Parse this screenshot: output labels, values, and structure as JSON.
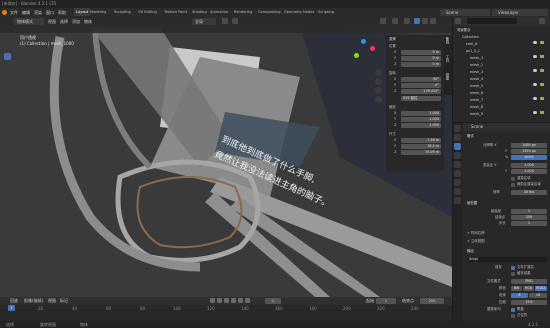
{
  "window_title": "[未保存] - Blender 4.2.1 LTS",
  "menu": [
    "文件",
    "编辑",
    "渲染",
    "窗口",
    "帮助"
  ],
  "workspaces": [
    "Layout",
    "Modeling",
    "Sculpting",
    "UV Editing",
    "Texture Paint",
    "Shading",
    "Animation",
    "Rendering",
    "Compositing",
    "Geometry Nodes",
    "Scripting"
  ],
  "active_workspace": "Layout",
  "header_right": {
    "scene": "Scene",
    "view_layer": "ViewLayer"
  },
  "viewport": {
    "mode": "物体模式",
    "menus": [
      "视图",
      "选择",
      "添加",
      "物体"
    ],
    "orientation": "全局",
    "info_title": "用户透视",
    "info_sub": "(1) Collection | mesh_1000",
    "overlay_text_line1": "到底他到底做了什么手脚,",
    "overlay_text_line2": "竟然让我没法读进主角的脑子。"
  },
  "npanel": {
    "tabs": [
      "条目",
      "工具",
      "视图"
    ],
    "transform_title": "变换",
    "location_label": "位置",
    "location": [
      {
        "axis": "X",
        "val": "0 m"
      },
      {
        "axis": "Y",
        "val": "0 m"
      },
      {
        "axis": "Z",
        "val": "0 m"
      }
    ],
    "rotation_label": "旋转",
    "rotation": [
      {
        "axis": "X",
        "val": "90°"
      },
      {
        "axis": "Y",
        "val": "-0°"
      },
      {
        "axis": "Z",
        "val": "178.412°"
      }
    ],
    "mode_value": "XYZ 欧拉",
    "scale_label": "缩放",
    "scale": [
      {
        "axis": "X",
        "val": "1.000"
      },
      {
        "axis": "Y",
        "val": "1.000"
      },
      {
        "axis": "Z",
        "val": "1.000"
      }
    ],
    "dims_label": "尺寸",
    "dims": [
      {
        "axis": "X",
        "val": "7.58 m"
      },
      {
        "axis": "Y",
        "val": "16.4 m"
      },
      {
        "axis": "Z",
        "val": "70.09 m"
      }
    ]
  },
  "outliner": {
    "title": "场景集合",
    "rows": [
      "Collection",
      "cam_A",
      "pc1_4_1",
      "mesh_1",
      "mesh_2",
      "mesh_3",
      "mesh_4",
      "mesh_5",
      "mesh_6",
      "mesh_7",
      "mesh_8",
      "mesh_9"
    ]
  },
  "properties": {
    "tab_label": "Scene",
    "format_title": "格式",
    "res_x_label": "分辨率 X",
    "res_x": "1080 px",
    "res_y_label": "Y",
    "res_y": "1920 px",
    "pct_label": "%",
    "pct": "100%",
    "aspect_x_label": "宽高比 X",
    "aspect_x": "1.000",
    "aspect_y_label": "Y",
    "aspect_y": "1.000",
    "border_label": "渲染区域",
    "crop_label": "裁剪至渲染区域",
    "fps_label": "帧率",
    "fps": "30 fps",
    "frame_range_title": "帧范围",
    "frame_start_label": "起始帧",
    "frame_start": "1",
    "frame_end_label": "结束点",
    "frame_end": "250",
    "frame_step_label": "步长",
    "frame_step": "1",
    "time_stretch_title": "> 时间拉伸",
    "stereo_title": "> 立体视图",
    "output_title": "输出",
    "output_path": "/tmp\\",
    "saving_label": "保存",
    "file_ext_label": "文件扩展名",
    "cache_label": "缓存结果",
    "file_format_label": "文件格式",
    "file_format": "PNG",
    "color_label": "颜色",
    "color_opts": [
      "BW",
      "RGB",
      "RGBA"
    ],
    "depth_label": "色深",
    "depth_opts": [
      "8",
      "16"
    ],
    "compression_label": "压缩",
    "compression": "15%",
    "image_seq_label": "图像序列",
    "overwrite_label": "覆盖",
    "placeholders_label": "占位符"
  },
  "timeline": {
    "menus": [
      "回放",
      "抠像(插帧)",
      "视图",
      "标记"
    ],
    "current_frame": "1",
    "start_label": "起始",
    "start": "1",
    "end_label": "结束点",
    "end": "250",
    "ticks": [
      "0",
      "20",
      "40",
      "60",
      "80",
      "100",
      "120",
      "140",
      "160",
      "180",
      "200",
      "220",
      "240"
    ]
  },
  "status": {
    "left": "选择",
    "mid": "旋转视图",
    "right": "物体",
    "version": "4.2.1"
  }
}
